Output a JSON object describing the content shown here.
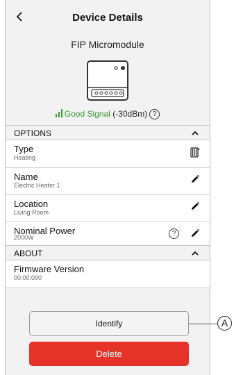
{
  "header": {
    "back_icon": "chevron-left-icon",
    "title": "Device Details"
  },
  "device": {
    "name": "FIP Micromodule",
    "signal_label": "Good Signal",
    "signal_value": "(-30dBm)",
    "signal_color": "#3a9a34",
    "help_symbol": "?"
  },
  "options": {
    "label": "OPTIONS",
    "rows": [
      {
        "title": "Type",
        "value": "Heating",
        "icon": "radiator-icon"
      },
      {
        "title": "Name",
        "value": "Electric Heater 1",
        "icon": "pencil-icon"
      },
      {
        "title": "Location",
        "value": "Living Room",
        "icon": "pencil-icon"
      },
      {
        "title": "Nominal Power",
        "value": "2000W",
        "icon": "pencil-icon",
        "help_symbol": "?"
      }
    ]
  },
  "about": {
    "label": "ABOUT",
    "rows": [
      {
        "title": "Firmware Version",
        "value": "00.00.000"
      }
    ]
  },
  "buttons": {
    "identify": "Identify",
    "delete": "Delete",
    "delete_color": "#e5332a"
  },
  "callout": {
    "label": "A"
  }
}
